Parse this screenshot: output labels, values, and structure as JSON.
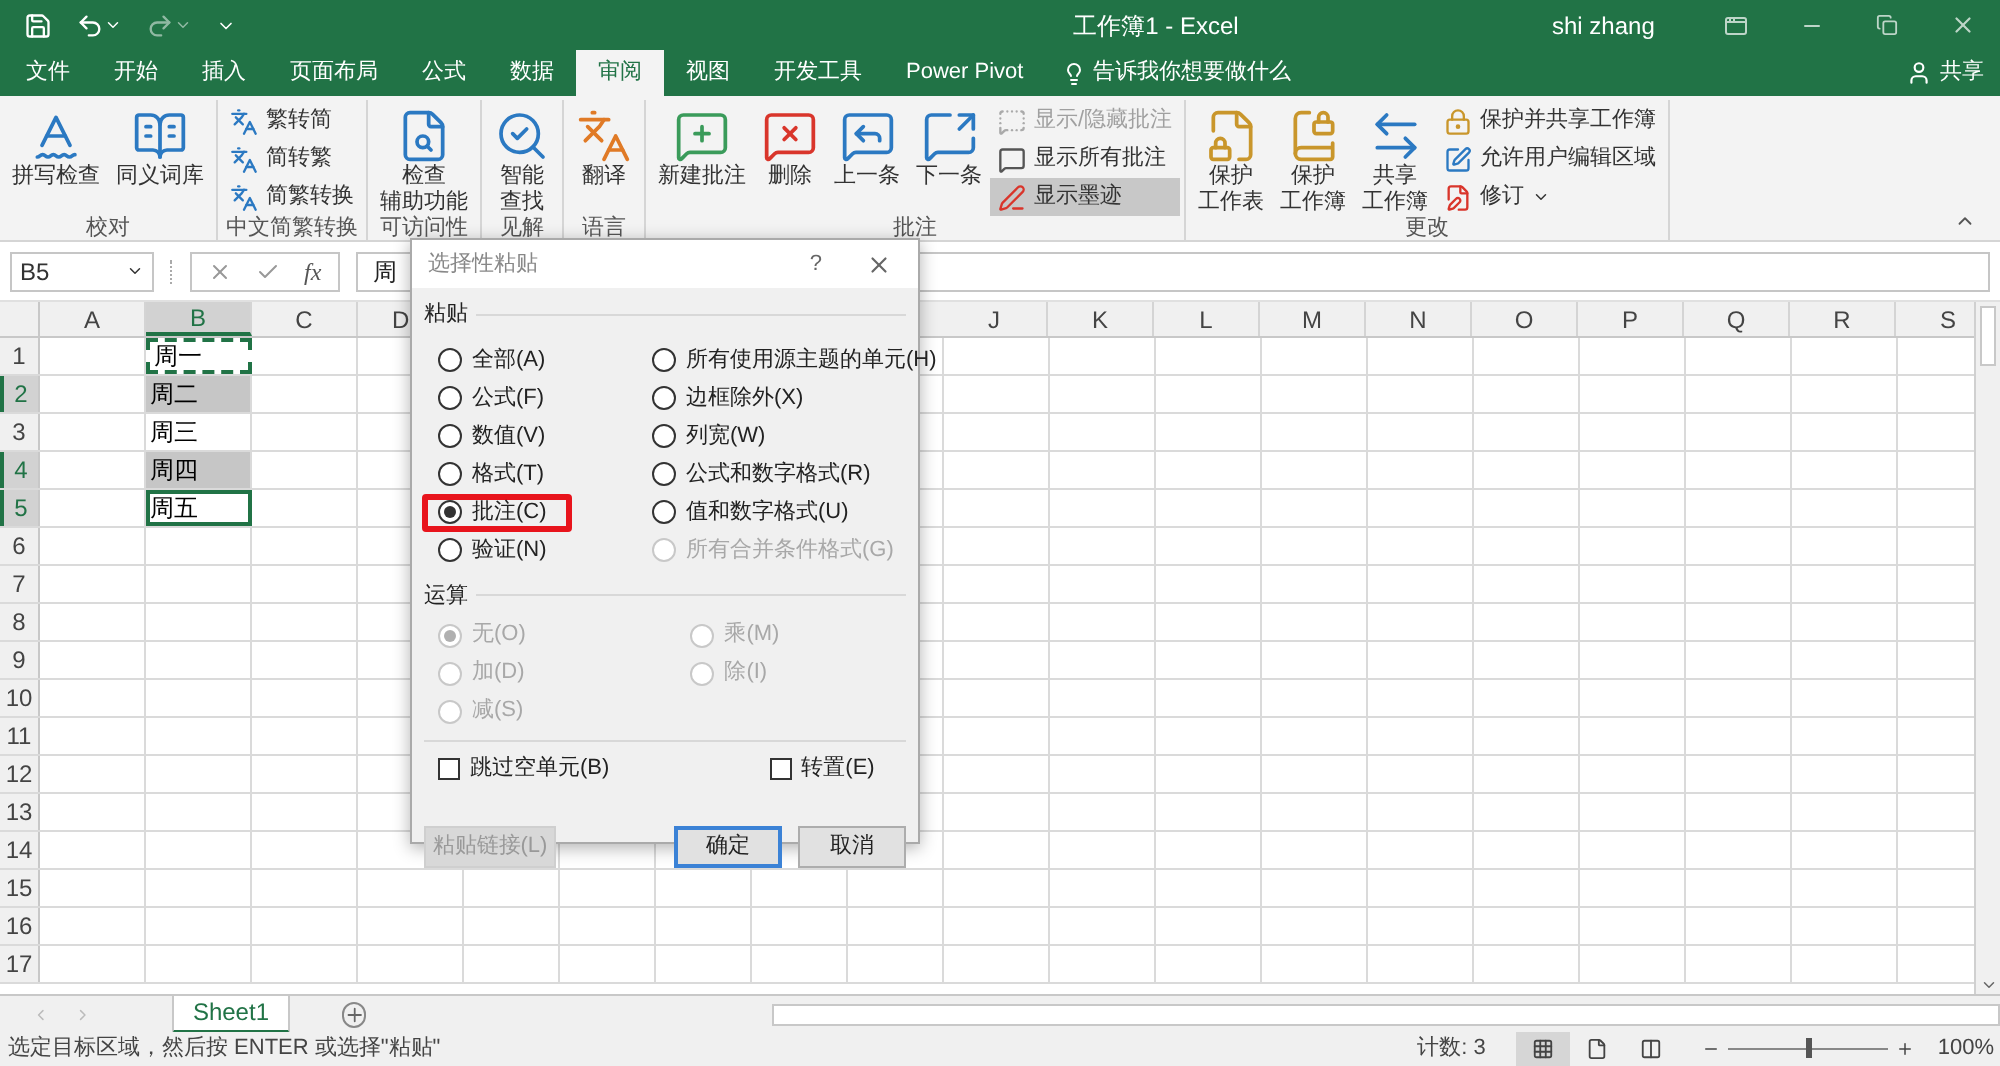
{
  "title_bar": {
    "title": "工作簿1 - Excel",
    "user": "shi zhang"
  },
  "tabs": [
    {
      "label": "文件",
      "selected": false
    },
    {
      "label": "开始",
      "selected": false
    },
    {
      "label": "插入",
      "selected": false
    },
    {
      "label": "页面布局",
      "selected": false
    },
    {
      "label": "公式",
      "selected": false
    },
    {
      "label": "数据",
      "selected": false
    },
    {
      "label": "审阅",
      "selected": true
    },
    {
      "label": "视图",
      "selected": false
    },
    {
      "label": "开发工具",
      "selected": false
    },
    {
      "label": "Power Pivot",
      "selected": false
    }
  ],
  "tell_me": "告诉我你想要做什么",
  "share": "共享",
  "ribbon_groups": [
    {
      "label": "校对",
      "items": [
        {
          "kind": "large",
          "lines": [
            "拼写检查"
          ]
        },
        {
          "kind": "large",
          "lines": [
            "同义词库"
          ]
        }
      ]
    },
    {
      "label": "中文简繁转换",
      "items": [
        {
          "kind": "small",
          "label": "繁转简"
        },
        {
          "kind": "small",
          "label": "简转繁"
        },
        {
          "kind": "small",
          "label": "简繁转换"
        }
      ]
    },
    {
      "label": "可访问性",
      "items": [
        {
          "kind": "large",
          "lines": [
            "检查",
            "辅助功能"
          ]
        }
      ]
    },
    {
      "label": "见解",
      "items": [
        {
          "kind": "large",
          "lines": [
            "智能",
            "查找"
          ]
        }
      ]
    },
    {
      "label": "语言",
      "items": [
        {
          "kind": "large",
          "lines": [
            "翻译"
          ]
        }
      ]
    },
    {
      "label": "批注",
      "items": [
        {
          "kind": "large",
          "lines": [
            "新建批注"
          ],
          "disabled": false,
          "pressed": false
        },
        {
          "kind": "large",
          "lines": [
            "删除"
          ],
          "disabled": false,
          "pressed": false
        },
        {
          "kind": "large",
          "lines": [
            "上一条"
          ],
          "disabled": false,
          "pressed": false
        },
        {
          "kind": "large",
          "lines": [
            "下一条"
          ],
          "disabled": false,
          "pressed": false
        },
        {
          "kind": "small",
          "label": "显示/隐藏批注",
          "disabled": true,
          "pressed": false
        },
        {
          "kind": "small",
          "label": "显示所有批注",
          "disabled": false,
          "pressed": false
        },
        {
          "kind": "small",
          "label": "显示墨迹",
          "disabled": false,
          "pressed": true
        }
      ]
    },
    {
      "label": "更改",
      "items": [
        {
          "kind": "large",
          "lines": [
            "保护",
            "工作表"
          ]
        },
        {
          "kind": "large",
          "lines": [
            "保护",
            "工作簿"
          ]
        },
        {
          "kind": "large",
          "lines": [
            "共享",
            "工作簿"
          ]
        },
        {
          "kind": "small",
          "label": "保护并共享工作簿"
        },
        {
          "kind": "small",
          "label": "允许用户编辑区域"
        },
        {
          "kind": "small",
          "label": "修订",
          "dropdown": true
        }
      ]
    }
  ],
  "formula_bar": {
    "name_box": "B5",
    "fx_label": "fx",
    "value": "周"
  },
  "grid": {
    "columns": [
      {
        "label": "A",
        "selected": false
      },
      {
        "label": "B",
        "selected": true
      },
      {
        "label": "C",
        "selected": false
      },
      {
        "label": "D",
        "selected": false
      },
      {
        "label": "J",
        "selected": false
      },
      {
        "label": "K",
        "selected": false
      },
      {
        "label": "L",
        "selected": false
      },
      {
        "label": "M",
        "selected": false
      },
      {
        "label": "N",
        "selected": false
      },
      {
        "label": "O",
        "selected": false
      },
      {
        "label": "P",
        "selected": false
      },
      {
        "label": "Q",
        "selected": false
      },
      {
        "label": "R",
        "selected": false
      },
      {
        "label": "S",
        "selected": false
      }
    ],
    "rows": [
      {
        "label": "1",
        "selected": false
      },
      {
        "label": "2",
        "selected": true
      },
      {
        "label": "3",
        "selected": false
      },
      {
        "label": "4",
        "selected": true
      },
      {
        "label": "5",
        "selected": true
      },
      {
        "label": "6",
        "selected": false
      },
      {
        "label": "7",
        "selected": false
      },
      {
        "label": "8",
        "selected": false
      },
      {
        "label": "9",
        "selected": false
      },
      {
        "label": "10",
        "selected": false
      },
      {
        "label": "11",
        "selected": false
      },
      {
        "label": "12",
        "selected": false
      },
      {
        "label": "13",
        "selected": false
      },
      {
        "label": "14",
        "selected": false
      },
      {
        "label": "15",
        "selected": false
      },
      {
        "label": "16",
        "selected": false
      },
      {
        "label": "17",
        "selected": false
      }
    ],
    "b_cells": [
      {
        "text": "周一",
        "selected": false,
        "active": false,
        "copied": true
      },
      {
        "text": "周二",
        "selected": true,
        "active": false,
        "copied": false
      },
      {
        "text": "周三",
        "selected": false,
        "active": false,
        "copied": false
      },
      {
        "text": "周四",
        "selected": true,
        "active": false,
        "copied": false
      },
      {
        "text": "周五",
        "selected": false,
        "active": true,
        "copied": false
      }
    ]
  },
  "dialog": {
    "title": "选择性粘贴",
    "help": "?",
    "paste": {
      "heading": "粘贴",
      "options": [
        {
          "label": "全部(A)",
          "selected": false,
          "disabled": false,
          "highlighted": false
        },
        {
          "label": "公式(F)",
          "selected": false,
          "disabled": false,
          "highlighted": false
        },
        {
          "label": "数值(V)",
          "selected": false,
          "disabled": false,
          "highlighted": false
        },
        {
          "label": "格式(T)",
          "selected": false,
          "disabled": false,
          "highlighted": false
        },
        {
          "label": "批注(C)",
          "selected": true,
          "disabled": false,
          "highlighted": true
        },
        {
          "label": "验证(N)",
          "selected": false,
          "disabled": false,
          "highlighted": false
        },
        {
          "label": "所有使用源主题的单元(H)",
          "selected": false,
          "disabled": false,
          "highlighted": false
        },
        {
          "label": "边框除外(X)",
          "selected": false,
          "disabled": false,
          "highlighted": false
        },
        {
          "label": "列宽(W)",
          "selected": false,
          "disabled": false,
          "highlighted": false
        },
        {
          "label": "公式和数字格式(R)",
          "selected": false,
          "disabled": false,
          "highlighted": false
        },
        {
          "label": "值和数字格式(U)",
          "selected": false,
          "disabled": false,
          "highlighted": false
        },
        {
          "label": "所有合并条件格式(G)",
          "selected": false,
          "disabled": true,
          "highlighted": false
        }
      ]
    },
    "operation": {
      "heading": "运算",
      "options": [
        {
          "label": "无(O)",
          "selected": true,
          "disabled": true
        },
        {
          "label": "加(D)",
          "selected": false,
          "disabled": true
        },
        {
          "label": "减(S)",
          "selected": false,
          "disabled": true
        },
        {
          "label": "乘(M)",
          "selected": false,
          "disabled": true
        },
        {
          "label": "除(I)",
          "selected": false,
          "disabled": true
        }
      ]
    },
    "checkboxes": [
      {
        "label": "跳过空单元(B)",
        "checked": false
      },
      {
        "label": "转置(E)",
        "checked": false
      }
    ],
    "buttons": [
      {
        "label": "粘贴链接(L)",
        "disabled": true,
        "default": false
      },
      {
        "label": "确定",
        "disabled": false,
        "default": true
      },
      {
        "label": "取消",
        "disabled": false,
        "default": false
      }
    ]
  },
  "sheet_tabs": [
    {
      "label": "Sheet1",
      "selected": true
    }
  ],
  "status_bar": {
    "message": "选定目标区域，然后按 ENTER 或选择\"粘贴\"",
    "count": "计数: 3",
    "views": [
      {
        "selected": true
      },
      {
        "selected": false
      },
      {
        "selected": false
      }
    ],
    "zoom": {
      "level": 0.5,
      "reading": "100%"
    }
  }
}
